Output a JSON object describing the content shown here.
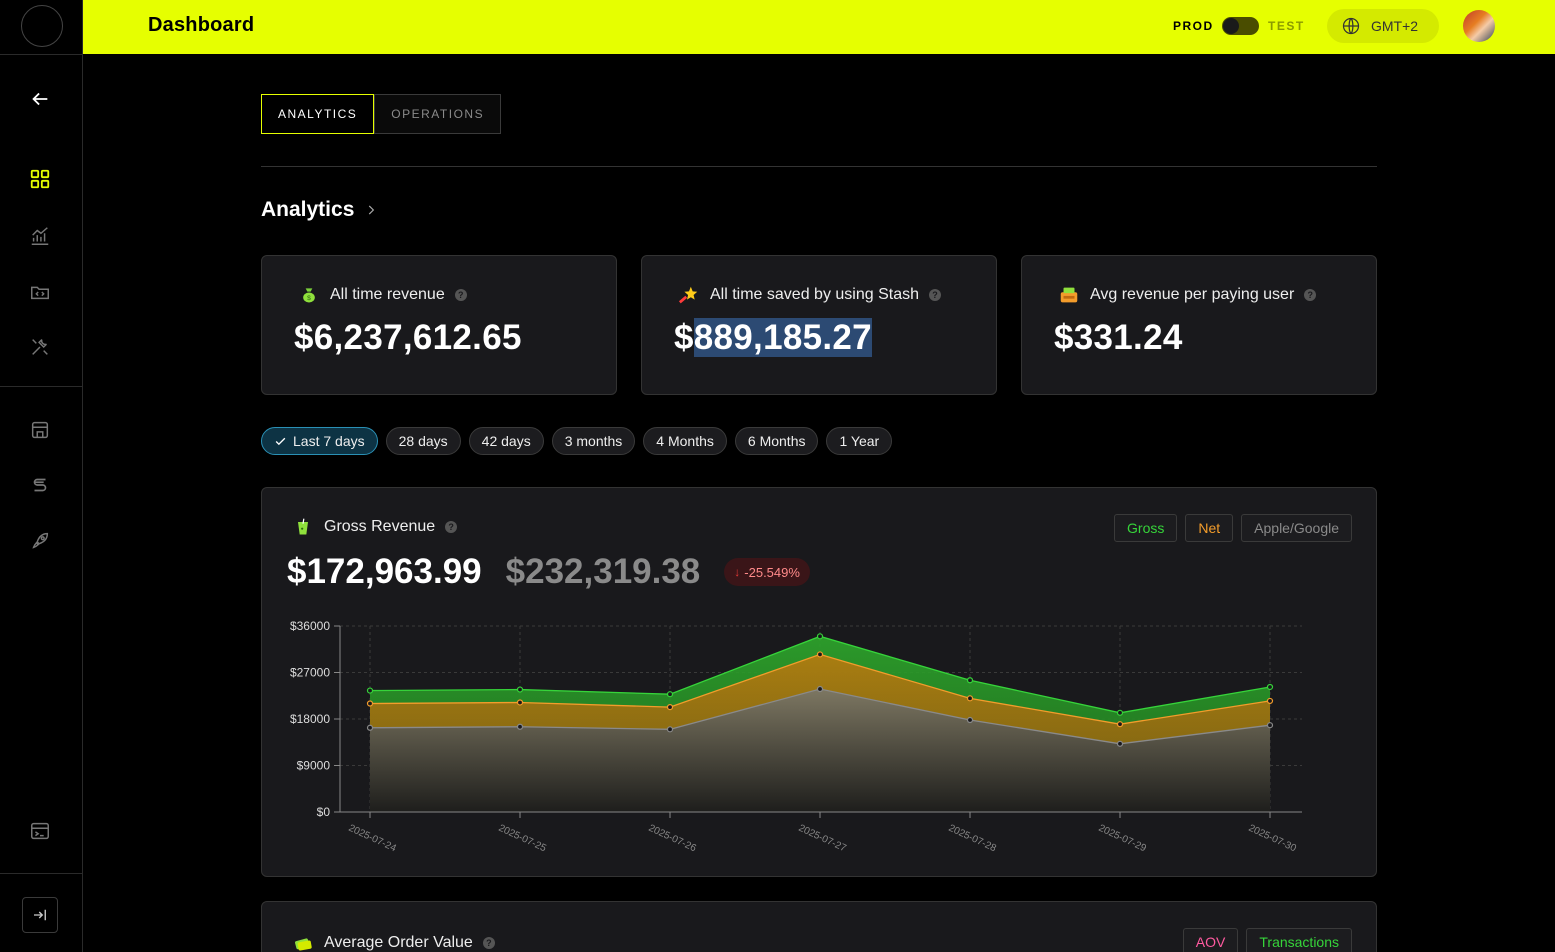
{
  "header": {
    "title": "Dashboard",
    "env_prod": "PROD",
    "env_test": "TEST",
    "timezone": "GMT+2"
  },
  "tabs": [
    {
      "label": "ANALYTICS",
      "active": true
    },
    {
      "label": "OPERATIONS",
      "active": false
    }
  ],
  "section": {
    "title": "Analytics"
  },
  "stats": [
    {
      "label": "All time revenue",
      "value": "$6,237,612.65",
      "icon": "money-bag-icon"
    },
    {
      "label": "All time saved by using Stash",
      "value_prefix": "$",
      "value_highlight": "889,185.27",
      "icon": "star-icon"
    },
    {
      "label": "Avg revenue per paying user",
      "value": "$331.24",
      "icon": "cash-register-icon"
    }
  ],
  "filters": [
    {
      "label": "Last 7 days",
      "active": true
    },
    {
      "label": "28 days",
      "active": false
    },
    {
      "label": "42 days",
      "active": false
    },
    {
      "label": "3 months",
      "active": false
    },
    {
      "label": "4 Months",
      "active": false
    },
    {
      "label": "6 Months",
      "active": false
    },
    {
      "label": "1 Year",
      "active": false
    }
  ],
  "gross_card": {
    "title": "Gross Revenue",
    "value": "$172,963.99",
    "previous": "$232,319.38",
    "delta": "-25.549%",
    "legend": {
      "gross": "Gross",
      "net": "Net",
      "store": "Apple/Google"
    }
  },
  "aov_card": {
    "title": "Average Order Value",
    "legend": {
      "aov": "AOV",
      "tx": "Transactions"
    }
  },
  "colors": {
    "accent": "#e6ff00",
    "gross": "#36d43a",
    "net": "#f39c2b",
    "store": "#8a8a8a"
  },
  "chart_data": {
    "type": "area",
    "categories": [
      "2025-07-24",
      "2025-07-25",
      "2025-07-26",
      "2025-07-27",
      "2025-07-28",
      "2025-07-29",
      "2025-07-30"
    ],
    "series": [
      {
        "name": "Gross",
        "values": [
          23500,
          23700,
          22800,
          34000,
          25500,
          19200,
          24200
        ]
      },
      {
        "name": "Net",
        "values": [
          21000,
          21200,
          20300,
          30500,
          22000,
          17000,
          21500
        ]
      },
      {
        "name": "Apple/Google",
        "values": [
          16300,
          16500,
          16000,
          23800,
          17800,
          13200,
          16800
        ]
      }
    ],
    "yticks": [
      "$0",
      "$9000",
      "$18000",
      "$27000",
      "$36000"
    ],
    "ylim": [
      0,
      36000
    ],
    "grid": true
  }
}
